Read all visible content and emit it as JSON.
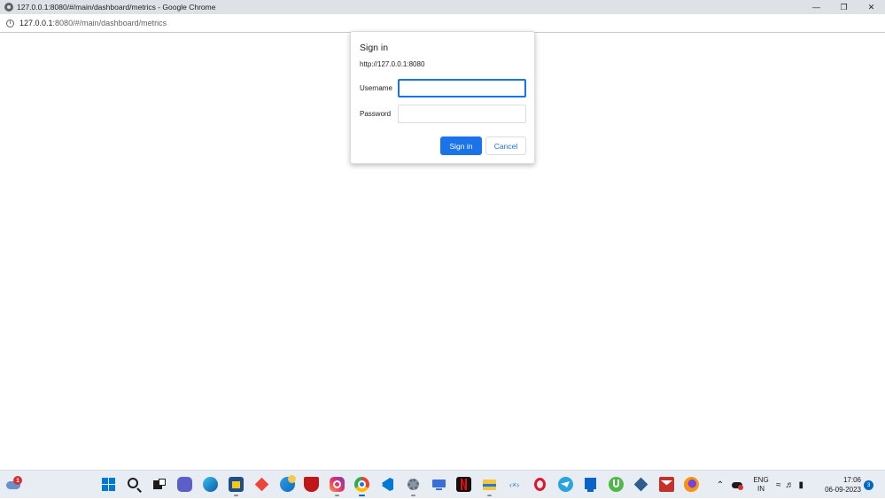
{
  "window": {
    "title": "127.0.0.1:8080/#/main/dashboard/metrics - Google Chrome",
    "controls": [
      "minimize-icon",
      "restore-icon",
      "close-icon"
    ]
  },
  "addressbar": {
    "url_host": "127.0.0.1",
    "url_path": ":8080/#/main/dashboard/metrics",
    "site_info_icon": "info-icon"
  },
  "auth_dialog": {
    "title": "Sign in",
    "origin": "http://127.0.0.1:8080",
    "username_label": "Username",
    "username_value": "",
    "password_label": "Password",
    "password_value": "",
    "signin_button": "Sign in",
    "cancel_button": "Cancel",
    "accent_color": "#1a73e8"
  },
  "taskbar": {
    "weather_badge": "1",
    "apps": [
      "start-icon",
      "search-icon",
      "task-view-icon",
      "teams-chat-icon",
      "edge-icon",
      "store-icon",
      "anydesk-icon",
      "photos-icon",
      "mcafee-icon",
      "instagram-icon",
      "chrome-icon",
      "vscode-icon",
      "settings-icon",
      "remote-desktop-icon",
      "netflix-icon",
      "file-explorer-icon",
      "xampp-icon",
      "opera-icon",
      "telegram-icon",
      "media-icon",
      "utorrent-icon",
      "virtualbox-icon",
      "mail-icon",
      "firefox-icon"
    ],
    "tray": {
      "language_line1": "ENG",
      "language_line2": "IN",
      "time": "17:06",
      "date": "06-09-2023",
      "notifications": "3"
    }
  }
}
